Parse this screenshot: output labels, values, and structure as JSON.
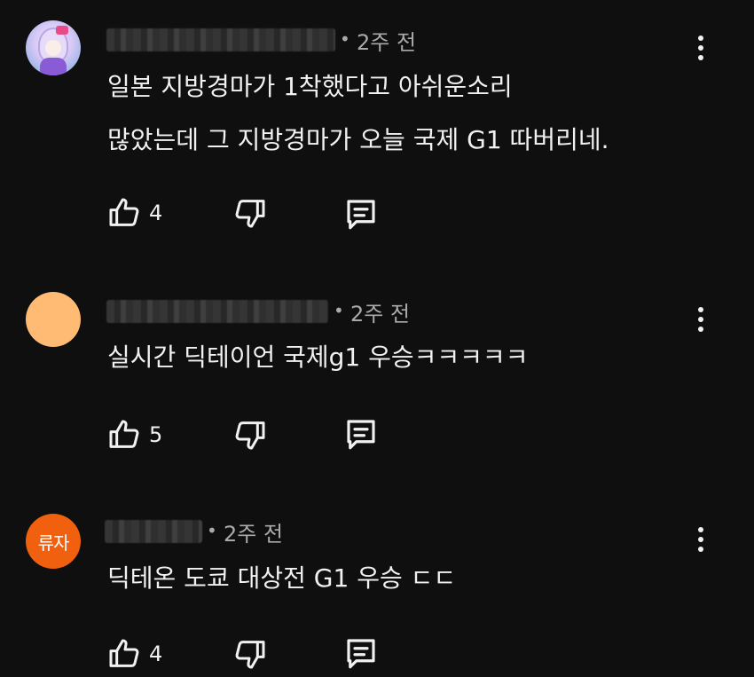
{
  "comments": [
    {
      "time": "2주 전",
      "text_lines": [
        "일본 지방경마가 1착했다고 아쉬운소리",
        "많았는데 그 지방경마가 오늘 국제 G1 따버리네."
      ],
      "likes": "4",
      "avatar_text": ""
    },
    {
      "time": "2주 전",
      "text_lines": [
        "실시간 딕테이언 국제g1 우승ㅋㅋㅋㅋㅋ"
      ],
      "likes": "5",
      "avatar_text": ""
    },
    {
      "time": "2주 전",
      "text_lines": [
        "딕테온 도쿄 대상전 G1 우승 ㄷㄷ"
      ],
      "likes": "4",
      "avatar_text": "류자"
    }
  ],
  "separator": "•",
  "colors": {
    "background": "#0f0f0f",
    "text": "#f1f1f1",
    "secondary": "#aaaaaa",
    "avatar_peach": "#ffbb73",
    "avatar_orange": "#f0600f"
  },
  "icons": [
    "thumbs-up-icon",
    "thumbs-down-icon",
    "reply-icon",
    "more-vert-icon"
  ]
}
